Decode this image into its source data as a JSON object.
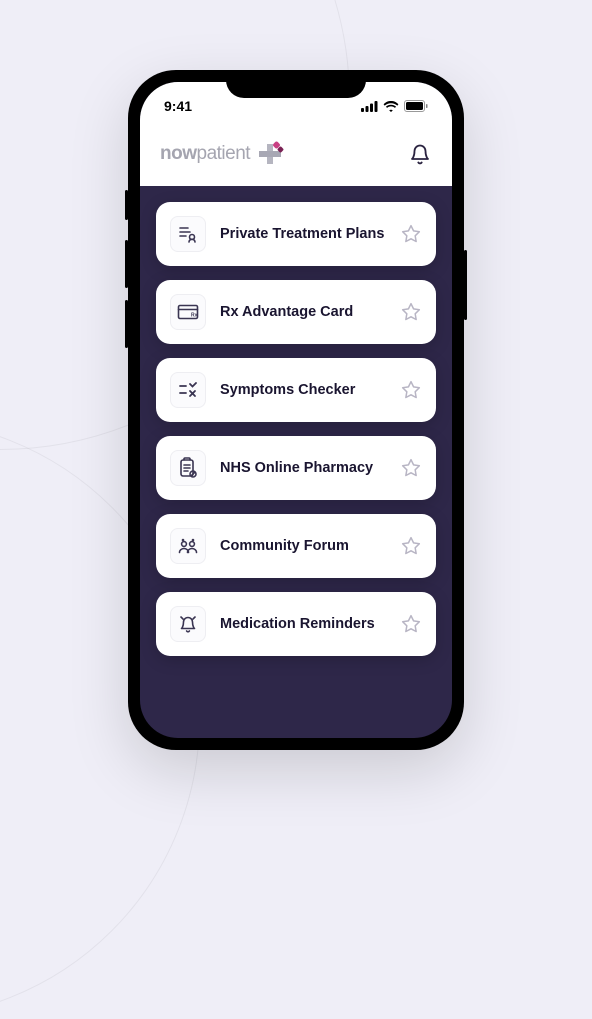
{
  "status_bar": {
    "time": "9:41"
  },
  "header": {
    "logo_bold": "now",
    "logo_light": "patient"
  },
  "cards": [
    {
      "label": "Private Treatment Plans",
      "icon": "treatment-plans-icon"
    },
    {
      "label": "Rx Advantage Card",
      "icon": "rx-card-icon"
    },
    {
      "label": "Symptoms Checker",
      "icon": "symptoms-checker-icon"
    },
    {
      "label": "NHS Online Pharmacy",
      "icon": "pharmacy-icon"
    },
    {
      "label": "Community Forum",
      "icon": "community-forum-icon"
    },
    {
      "label": "Medication Reminders",
      "icon": "medication-reminders-icon"
    }
  ]
}
